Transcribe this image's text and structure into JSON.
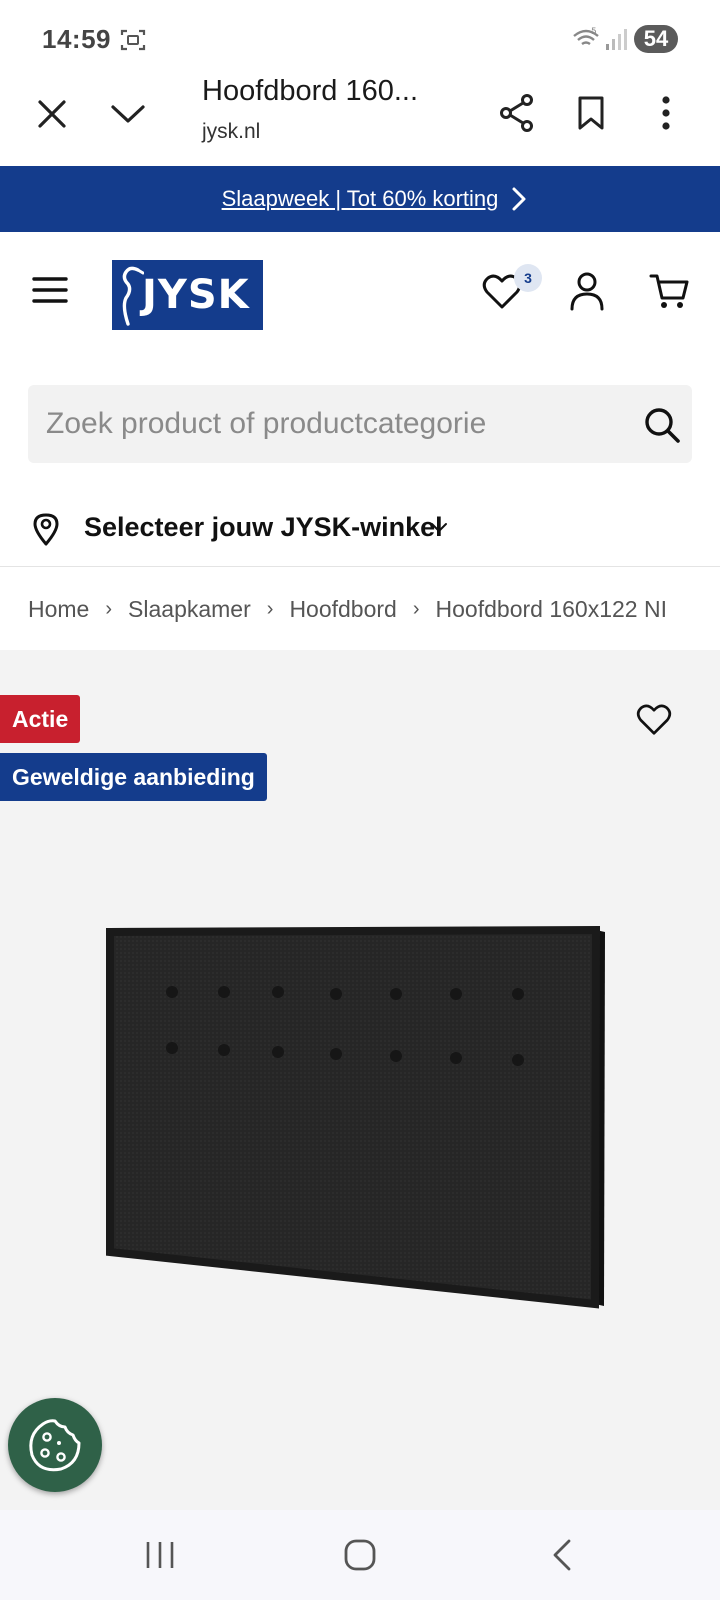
{
  "status_bar": {
    "time": "14:59",
    "battery": "54",
    "icons": [
      "screenshot-icon",
      "wifi-icon",
      "signal-icon"
    ]
  },
  "browser": {
    "tab_title": "Hoofdbord 160...",
    "url": "jysk.nl",
    "icons": [
      "close-icon",
      "chevron-down-icon",
      "share-icon",
      "bookmark-icon",
      "more-vertical-icon"
    ]
  },
  "promo": {
    "text": "Slaapweek | Tot 60% korting",
    "bg_color": "#143c8c"
  },
  "header": {
    "logo_text": "JYSK",
    "wishlist_count": "3",
    "brand_color": "#143c8c",
    "icons": [
      "menu-icon",
      "heart-icon",
      "user-icon",
      "cart-icon"
    ]
  },
  "search": {
    "placeholder": "Zoek product of productcategorie",
    "value": ""
  },
  "store": {
    "label": "Selecteer jouw JYSK-winkel"
  },
  "breadcrumb": {
    "items": [
      "Home",
      "Slaapkamer",
      "Hoofdbord",
      "Hoofdbord 160x122 NI"
    ]
  },
  "product": {
    "badges": {
      "sale": "Actie",
      "deal": "Geweldige aanbieding"
    },
    "sale_color": "#c8202e",
    "deal_color": "#143c8c"
  },
  "cookie": {
    "icon": "cookie-icon",
    "color": "#2f6148"
  },
  "nav": {
    "icons": [
      "recent-apps-icon",
      "home-icon",
      "back-icon"
    ]
  }
}
